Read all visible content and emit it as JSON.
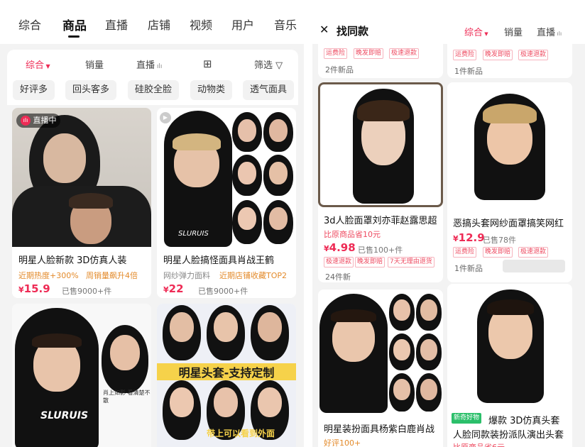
{
  "left": {
    "tabs": [
      "综合",
      "商品",
      "直播",
      "店铺",
      "视频",
      "用户",
      "音乐"
    ],
    "active_tab": "商品",
    "sort": {
      "comprehensive": "综合",
      "sales": "销量",
      "live": "直播",
      "filter": "筛选"
    },
    "chips": [
      "好评多",
      "回头客多",
      "硅胶全脸",
      "动物类",
      "透气面具"
    ],
    "products": [
      {
        "title": "明星人脸新款 3D仿真人装",
        "sub1": "近期热度+300%",
        "sub2": "周销量飙升4倍",
        "price": "15.9",
        "sold": "已售9000+件",
        "live_badge": "直播中"
      },
      {
        "title": "明星人脸搞怪面具肖战王鹤",
        "sub1": "网纱弹力面料",
        "sub2": "近期店铺收藏TOP2",
        "price": "22",
        "sold": "已售9000+件",
        "img_text": "SLURUIS"
      },
      {
        "img_text": "SLURUIS",
        "img_caption": "肖上如影·看清楚不散"
      },
      {
        "banner1": "明星头套-支持定制",
        "banner2": "带上可以看到外面"
      }
    ]
  },
  "right": {
    "header": {
      "close": "✕",
      "title": "找同款",
      "sort_comprehensive": "综合",
      "sort_sales": "销量",
      "sort_live": "直播"
    },
    "top_left": {
      "badges": [
        "运费险",
        "晚发即赔",
        "极速退款"
      ],
      "new": "2件新品"
    },
    "top_right": {
      "badges": [
        "运费险",
        "晚发即赔",
        "极速退款"
      ],
      "new": "1件新品"
    },
    "products": [
      {
        "title": "3d人脸面罩刘亦菲赵露思超",
        "compare": "比原商品省10元",
        "price": "4.98",
        "sold": "已售100+件",
        "badges": [
          "极速退款",
          "晚发即赔",
          "7天无理由退货"
        ],
        "new": "24件新"
      },
      {
        "title": "恶搞头套网纱面罩搞笑网红",
        "price": "12.9",
        "sold": "已售78件",
        "badges": [
          "运费险",
          "晚发即赔",
          "极速退款"
        ],
        "new": "1件新品"
      },
      {
        "title": "明星装扮面具杨紫白鹿肖战",
        "sub": "好评100+"
      },
      {
        "new_badge": "新奇好物",
        "title1": "爆款 3D仿真头套",
        "title2": "人脸同款装扮派队演出头套",
        "compare": "比原商品省6元"
      }
    ]
  },
  "colors": {
    "accent": "#ee2b55",
    "badge": "#ee4b61",
    "orange": "#e38a2a"
  }
}
